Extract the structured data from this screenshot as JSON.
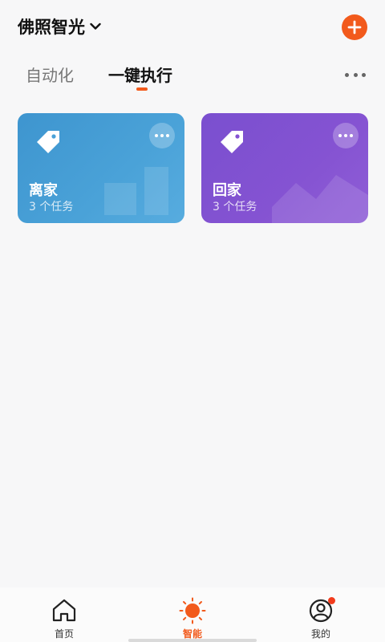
{
  "header": {
    "home_name": "佛照智光"
  },
  "tabs": [
    {
      "label": "自动化",
      "active": false
    },
    {
      "label": "一键执行",
      "active": true
    }
  ],
  "scenes": [
    {
      "title": "离家",
      "subtitle": "3 个任务",
      "color": "#3e95cf"
    },
    {
      "title": "回家",
      "subtitle": "3 个任务",
      "color": "#7a4fcf"
    }
  ],
  "bottom_nav": [
    {
      "label": "首页",
      "icon": "home-icon",
      "active": false
    },
    {
      "label": "智能",
      "icon": "sun-icon",
      "active": true
    },
    {
      "label": "我的",
      "icon": "profile-icon",
      "active": false,
      "badge": true
    }
  ],
  "colors": {
    "accent": "#f25a1c",
    "background": "#f7f7f8"
  }
}
